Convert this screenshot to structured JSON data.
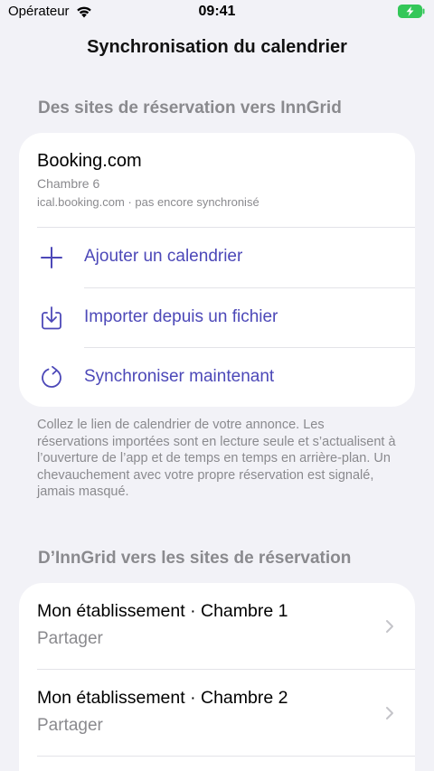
{
  "status_bar": {
    "carrier": "Opérateur",
    "time": "09:41"
  },
  "nav": {
    "title": "Synchronisation du calendrier"
  },
  "import_section": {
    "header": "Des sites de réservation vers InnGrid",
    "calendar": {
      "name": "Booking.com",
      "room": "Chambre 6",
      "meta": "ical.booking.com · pas encore synchronisé"
    },
    "actions": [
      {
        "label": "Ajouter un calendrier",
        "icon": "plus-icon"
      },
      {
        "label": "Importer depuis un fichier",
        "icon": "import-file-icon"
      },
      {
        "label": "Synchroniser maintenant",
        "icon": "sync-icon"
      }
    ],
    "footer": "Collez le lien de calendrier de votre annonce. Les réservations importées sont en lecture seule et s’actualisent à l’ouverture de l’app et de temps en temps en arrière-plan. Un chevauchement avec votre propre réservation est signalé, jamais masqué."
  },
  "export_section": {
    "header": "D’InnGrid vers les sites de réservation",
    "rows": [
      {
        "title": "Mon établissement · Chambre 1",
        "subtitle": "Partager"
      },
      {
        "title": "Mon établissement · Chambre 2",
        "subtitle": "Partager"
      }
    ]
  },
  "colors": {
    "accent": "#4c48b8",
    "battery": "#34c759",
    "secondary_text": "#8a8a8e",
    "background": "#f2f2f7"
  }
}
